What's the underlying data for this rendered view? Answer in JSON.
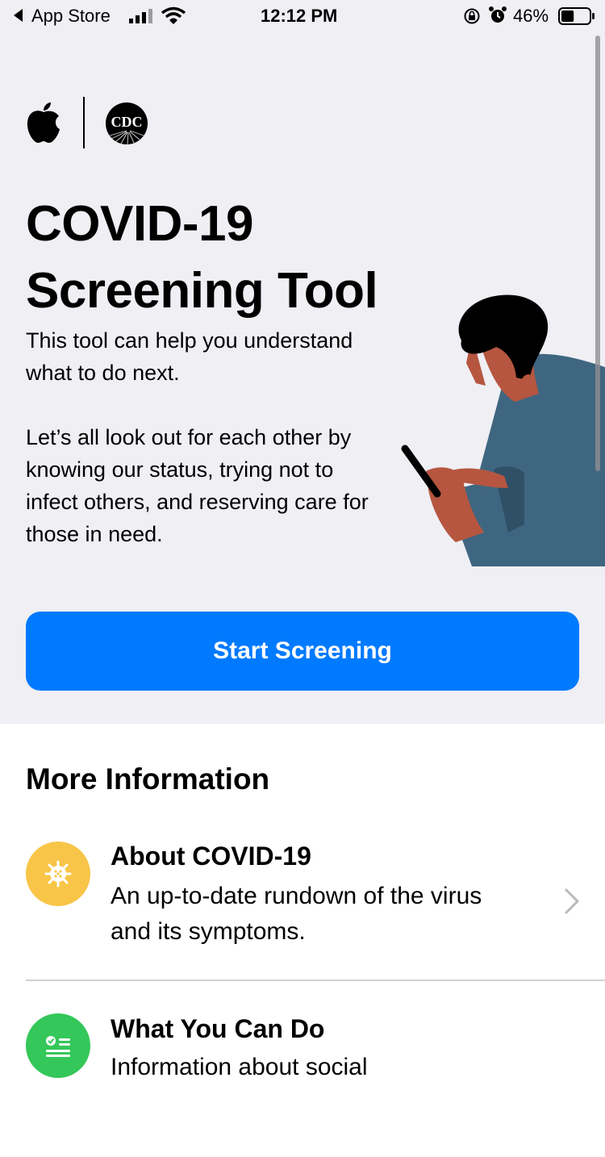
{
  "status_bar": {
    "back_app": "App Store",
    "time": "12:12 PM",
    "battery": "46%",
    "battery_level": 0.46
  },
  "hero": {
    "title_line1": "COVID-19",
    "title_line2": "Screening Tool",
    "description1": "This tool can help you understand what to do next.",
    "description2": "Let’s all look out for each other by knowing our status, trying not to infect others, and reserving care for those in need.",
    "start_button_label": "Start Screening",
    "cdc_logo_text": "CDC"
  },
  "more_info": {
    "section_title": "More Information",
    "items": [
      {
        "title": "About COVID-19",
        "description": "An up-to-date rundown of the virus and its symptoms.",
        "icon": "virus-icon",
        "icon_color": "#f8c548"
      },
      {
        "title": "What You Can Do",
        "description": "Information about social",
        "icon": "checklist-icon",
        "icon_color": "#34c759"
      }
    ]
  },
  "colors": {
    "accent": "#007aff",
    "hero_background": "#efeff4",
    "illustration_skin": "#b65640",
    "illustration_shirt": "#3f6680"
  }
}
